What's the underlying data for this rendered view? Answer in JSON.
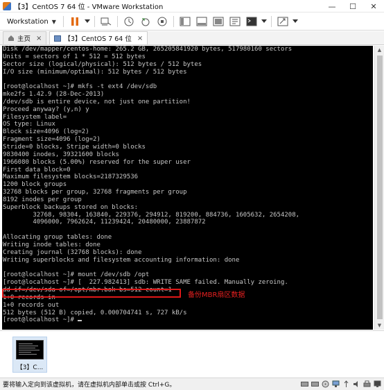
{
  "window": {
    "title": "【3】CentOS 7 64 位 - VMware Workstation",
    "minimize": "—",
    "maximize": "☐",
    "close": "✕"
  },
  "toolbar": {
    "menu_label": "Workstation",
    "menu_caret": "▼"
  },
  "tabs": [
    {
      "label": "主页"
    },
    {
      "label": "【3】CentOS 7 64 位"
    }
  ],
  "tab_close": "×",
  "terminal": {
    "lines": [
      "Disk /dev/mapper/centos-home: 265.2 GB, 265205841920 bytes, 517980160 sectors",
      "Units = sectors of 1 * 512 = 512 bytes",
      "Sector size (logical/physical): 512 bytes / 512 bytes",
      "I/O size (minimum/optimal): 512 bytes / 512 bytes",
      "",
      "[root@localhost ~]# mkfs -t ext4 /dev/sdb",
      "mke2fs 1.42.9 (28-Dec-2013)",
      "/dev/sdb is entire device, not just one partition!",
      "Proceed anyway? (y,n) y",
      "Filesystem label=",
      "OS type: Linux",
      "Block size=4096 (log=2)",
      "Fragment size=4096 (log=2)",
      "Stride=0 blocks, Stripe width=0 blocks",
      "9830400 inodes, 39321600 blocks",
      "1966080 blocks (5.00%) reserved for the super user",
      "First data block=0",
      "Maximum filesystem blocks=2187329536",
      "1200 block groups",
      "32768 blocks per group, 32768 fragments per group",
      "8192 inodes per group",
      "Superblock backups stored on blocks:",
      "        32768, 98304, 163840, 229376, 294912, 819200, 884736, 1605632, 2654208,",
      "        4096000, 7962624, 11239424, 20480000, 23887872",
      "",
      "Allocating group tables: done",
      "Writing inode tables: done",
      "Creating journal (32768 blocks): done",
      "Writing superblocks and filesystem accounting information: done",
      "",
      "[root@localhost ~]# mount /dev/sdb /opt",
      "[root@localhost ~]# [  227.982413] sdb: WRITE SAME failed. Manually zeroing.",
      "dd if=/dev/sda of=/opt/mbr.bak bs=512 count=1",
      "1+0 records in",
      "1+0 records out",
      "512 bytes (512 B) copied, 0.000704741 s, 727 kB/s",
      "[root@localhost ~]# "
    ],
    "annotation": "备份MBR扇区数据"
  },
  "thumbnail": {
    "label": "【3】C..."
  },
  "status": {
    "text": "要将输入定向到该虚拟机，请在虚拟机内部单击或按 Ctrl+G。"
  }
}
